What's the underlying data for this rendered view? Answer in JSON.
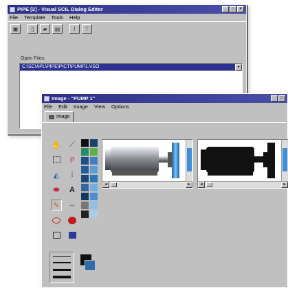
{
  "dialog_editor": {
    "title": "PIPE [2] - Visual SCIL Dialog Editor",
    "menu": [
      "File",
      "Template",
      "Tools",
      "Help"
    ],
    "toolbar_icons": [
      "dialog-icon",
      "new-icon",
      "open-icon",
      "save-icon",
      "info-icon",
      "find-icon"
    ],
    "open_files_label": "Open Files:",
    "open_files": [
      "C:\\SC\\APL\\PIPE\\PICT\\PUMP1.VSO"
    ]
  },
  "image_editor": {
    "title": "Image - \"PUMP 1\"",
    "menu": [
      "File",
      "Edit",
      "Image",
      "View",
      "Options"
    ],
    "tab_label": "Image",
    "tools": [
      "hand-icon",
      "eyedropper-icon",
      "select-rect-icon",
      "lasso-icon",
      "fill-icon",
      "spray-icon",
      "eraser-icon",
      "text-icon",
      "pencil-icon",
      "curve-icon",
      "ellipse-icon",
      "filled-ellipse-icon",
      "rectangle-icon",
      "filled-rectangle-icon"
    ],
    "palette": [
      "#111111",
      "#1f3f6c",
      "#2a8a6a",
      "#5fb04a",
      "#1f4f86",
      "#3f7fc0",
      "#245d9a",
      "#5a9ed8",
      "#1b4878",
      "#2c76b8",
      "#3366a0",
      "#6fb0e0",
      "#15375e",
      "#4b8fd0",
      "#777777",
      "#8fc0e8",
      "#222222",
      "#aacde8"
    ],
    "foreground_color": "#111111",
    "background_color": "#2e6ea8"
  }
}
